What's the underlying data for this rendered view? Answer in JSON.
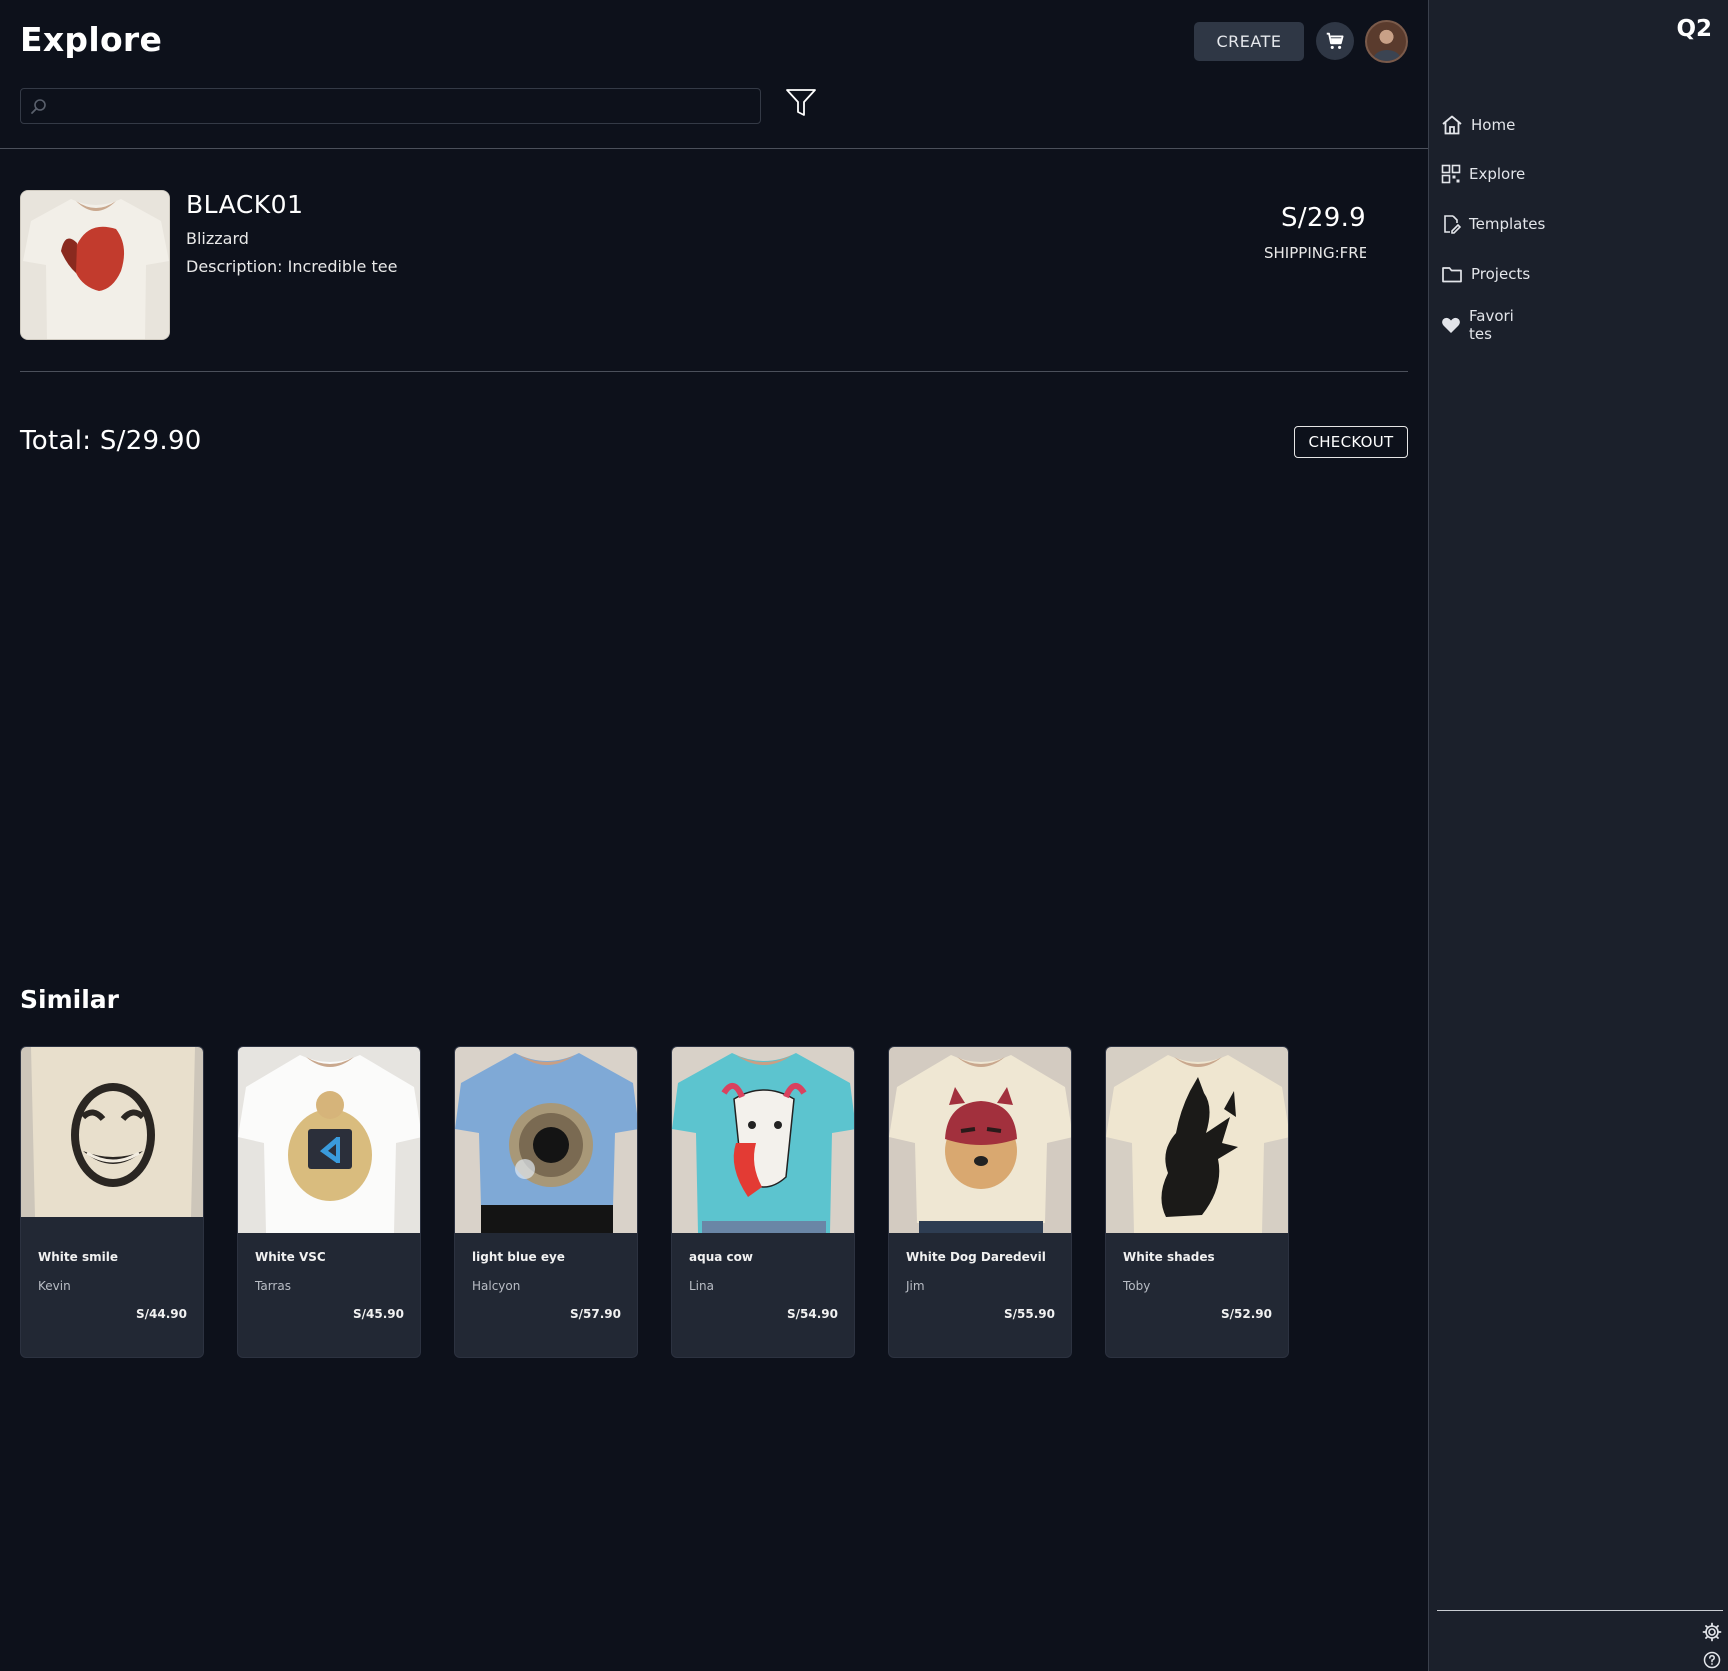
{
  "header": {
    "title": "Explore",
    "create_label": "CREATE",
    "cart_icon": "shopping-cart-icon",
    "avatar_icon": "user-avatar"
  },
  "search": {
    "value": "",
    "placeholder": ""
  },
  "cart": {
    "item": {
      "name": "BLACK01",
      "brand": "Blizzard",
      "description": "Description: Incredible tee",
      "price": "S/29.9",
      "shipping": "SHIPPING:FREE"
    },
    "total_label": "Total: S/29.90",
    "checkout_label": "CHECKOUT"
  },
  "similar": {
    "title": "Similar",
    "products": [
      {
        "name": "White smile",
        "author": "Kevin",
        "price": "S/44.90"
      },
      {
        "name": "White VSC",
        "author": "Tarras",
        "price": "S/45.90"
      },
      {
        "name": "light blue eye",
        "author": "Halcyon",
        "price": "S/57.90"
      },
      {
        "name": "aqua cow",
        "author": "Lina",
        "price": "S/54.90"
      },
      {
        "name": "White Dog Daredevil",
        "author": "Jim",
        "price": "S/55.90"
      },
      {
        "name": "White shades",
        "author": "Toby",
        "price": "S/52.90"
      }
    ]
  },
  "sidebar": {
    "logo": "Q2",
    "items": [
      {
        "label": "Home",
        "icon": "home-icon"
      },
      {
        "label": "Explore",
        "icon": "grid-icon"
      },
      {
        "label": "Templates",
        "icon": "edit-document-icon"
      },
      {
        "label": "Projects",
        "icon": "folder-icon"
      },
      {
        "label": "Favori tes",
        "icon": "heart-icon"
      }
    ],
    "bottom_icons": [
      "settings-icon",
      "help-icon"
    ]
  },
  "colors": {
    "background": "#0d111b",
    "sidebar": "#1b202b",
    "card": "#222834",
    "button": "#2f3745"
  }
}
